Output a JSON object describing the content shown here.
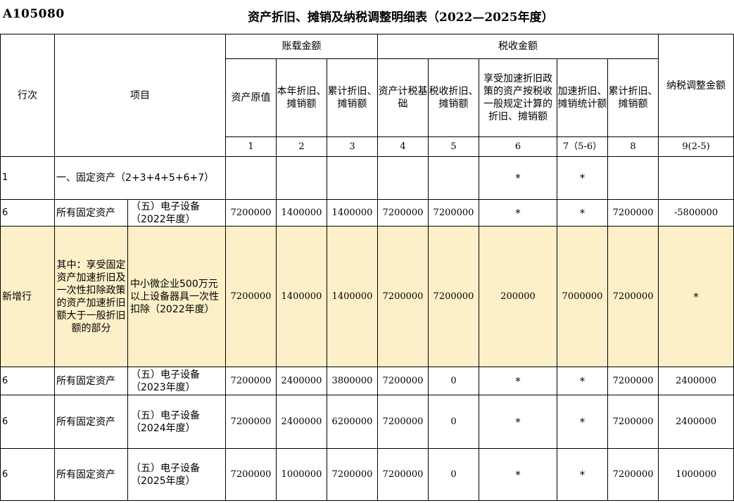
{
  "form": {
    "code": "A105080",
    "title": "资产折旧、摊销及纳税调整明细表（2022—2025年度）"
  },
  "header": {
    "row_no": "行次",
    "item": "项目",
    "book_group": "账载金额",
    "tax_group": "税收金额",
    "adjust": "纳税调整金额",
    "cols": [
      {
        "label": "资产原值",
        "no": "1"
      },
      {
        "label": "本年折旧、摊销额",
        "no": "2"
      },
      {
        "label": "累计折旧、摊销额",
        "no": "3"
      },
      {
        "label": "资产计税基础",
        "no": "4"
      },
      {
        "label": "税收折旧、摊销额",
        "no": "5"
      },
      {
        "label": "享受加速折旧政策的资产按税收一般规定计算的折旧、摊销额",
        "no": "6"
      },
      {
        "label": "加速折旧、摊销统计额",
        "no": "7（5-6）"
      },
      {
        "label": "累计折旧、摊销额",
        "no": "8"
      }
    ],
    "adjust_no": "9(2-5)"
  },
  "rows": [
    {
      "row_no": "1",
      "item": "一、固定资产（2+3+4+5+6+7）",
      "values": [
        "",
        "",
        "",
        "",
        "",
        "*",
        "*",
        "",
        ""
      ]
    },
    {
      "row_no": "6",
      "item_a": "所有固定资产",
      "item_b": "（五）电子设备（2022年度）",
      "values": [
        "7200000",
        "1400000",
        "1400000",
        "7200000",
        "7200000",
        "*",
        "*",
        "7200000",
        "-5800000"
      ]
    },
    {
      "row_no": "新增行",
      "item_a": "其中：享受固定资产加速折旧及一次性扣除政策的资产加速折旧额大于一般折旧额的部分",
      "item_b": "中小微企业500万元以上设备器具一次性扣除（2022年度）",
      "values": [
        "7200000",
        "1400000",
        "1400000",
        "7200000",
        "7200000",
        "200000",
        "7000000",
        "7200000",
        "*"
      ]
    },
    {
      "row_no": "6",
      "item_a": "所有固定资产",
      "item_b": "（五）电子设备（2023年度）",
      "values": [
        "7200000",
        "2400000",
        "3800000",
        "7200000",
        "0",
        "*",
        "*",
        "7200000",
        "2400000"
      ]
    },
    {
      "row_no": "6",
      "item_a": "所有固定资产",
      "item_b": "（五）电子设备（2024年度）",
      "values": [
        "7200000",
        "2400000",
        "6200000",
        "7200000",
        "0",
        "*",
        "*",
        "7200000",
        "2400000"
      ]
    },
    {
      "row_no": "6",
      "item_a": "所有固定资产",
      "item_b": "（五）电子设备（2025年度）",
      "values": [
        "7200000",
        "1000000",
        "7200000",
        "7200000",
        "0",
        "*",
        "*",
        "7200000",
        "1000000"
      ]
    }
  ]
}
